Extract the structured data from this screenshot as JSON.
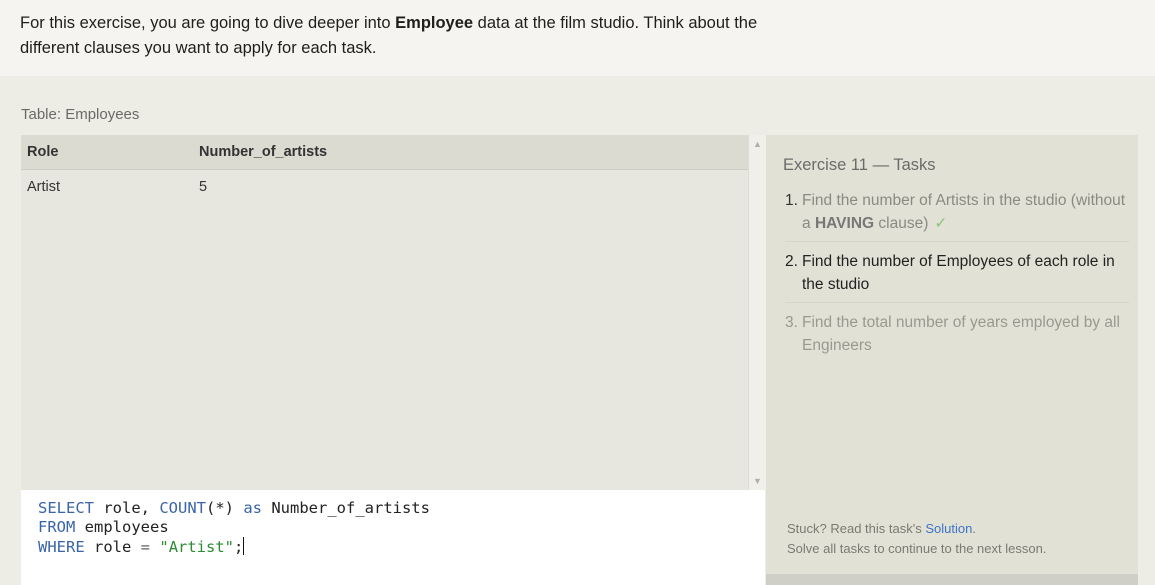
{
  "intro": {
    "text_before": "For this exercise, you are going to dive deeper into ",
    "bold": "Employee",
    "text_after": " data at the film studio. Think about the different clauses you want to apply for each task."
  },
  "table_caption": "Table: Employees",
  "result": {
    "columns": [
      "Role",
      "Number_of_artists"
    ],
    "rows": [
      [
        "Artist",
        "5"
      ]
    ]
  },
  "editor": {
    "line1": {
      "kw1": "SELECT",
      "t1": " role, ",
      "kw2": "COUNT",
      "t2": "(*) ",
      "kw3": "as",
      "t3": " Number_of_artists"
    },
    "line2": {
      "kw": "FROM",
      "t": " employees"
    },
    "line3": {
      "kw": "WHERE",
      "t1": " role ",
      "op": "=",
      "t2": " ",
      "str": "\"Artist\"",
      "t3": ";"
    }
  },
  "panel": {
    "title": "Exercise 11 — Tasks",
    "tasks": [
      {
        "num": "1.",
        "text_before": "Find the number of Artists in the studio (without a ",
        "bold": "HAVING",
        "text_after": " clause)",
        "check": "✓"
      },
      {
        "num": "2.",
        "text": "Find the number of Employees of each role in the studio"
      },
      {
        "num": "3.",
        "text": "Find the total number of years employed by all Engineers"
      }
    ],
    "help": {
      "stuck_prefix": "Stuck? Read this task's ",
      "solution_link": "Solution",
      "stuck_suffix": ".",
      "continue": "Solve all tasks to continue to the next lesson."
    }
  },
  "colors": {
    "keyword": "#3a64a8",
    "string": "#2f8b34",
    "link": "#3b74c8",
    "check": "#8cc47a"
  }
}
